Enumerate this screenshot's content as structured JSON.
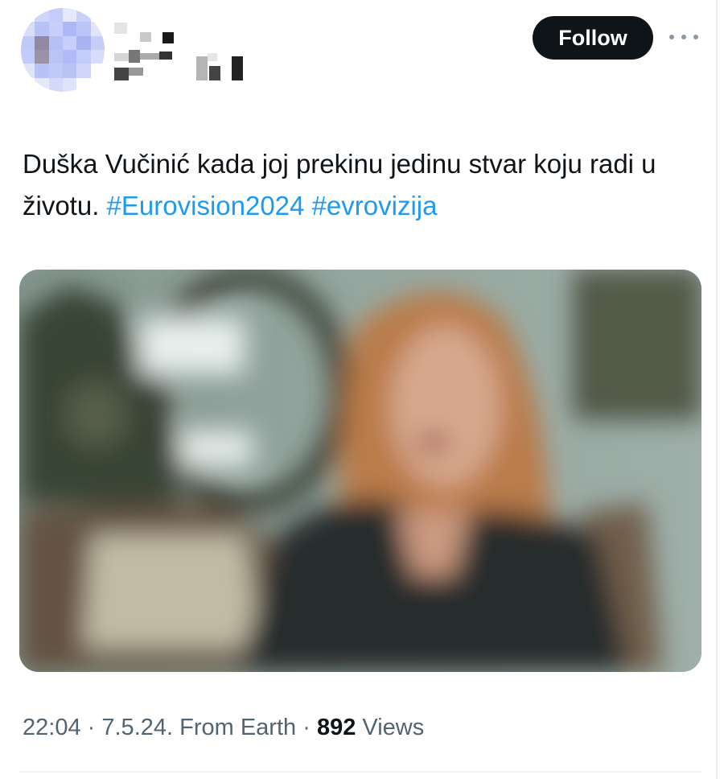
{
  "header": {
    "follow_label": "Follow",
    "more_icon": "more-horizontal-icon"
  },
  "tweet": {
    "text_main": "Duška Vučinić kada joj prekinu jedinu stvar koju radi u životu. ",
    "hashtags": [
      "#Eurovision2024",
      "#evrovizija"
    ],
    "time": "22:04",
    "date": "7.5.24.",
    "source": "From Earth",
    "views_count": "892",
    "views_label": "Views"
  },
  "colors": {
    "accent": "#1d9bf0",
    "text_primary": "#0f1419",
    "text_secondary": "#536471",
    "follow_bg": "#0f1419"
  }
}
